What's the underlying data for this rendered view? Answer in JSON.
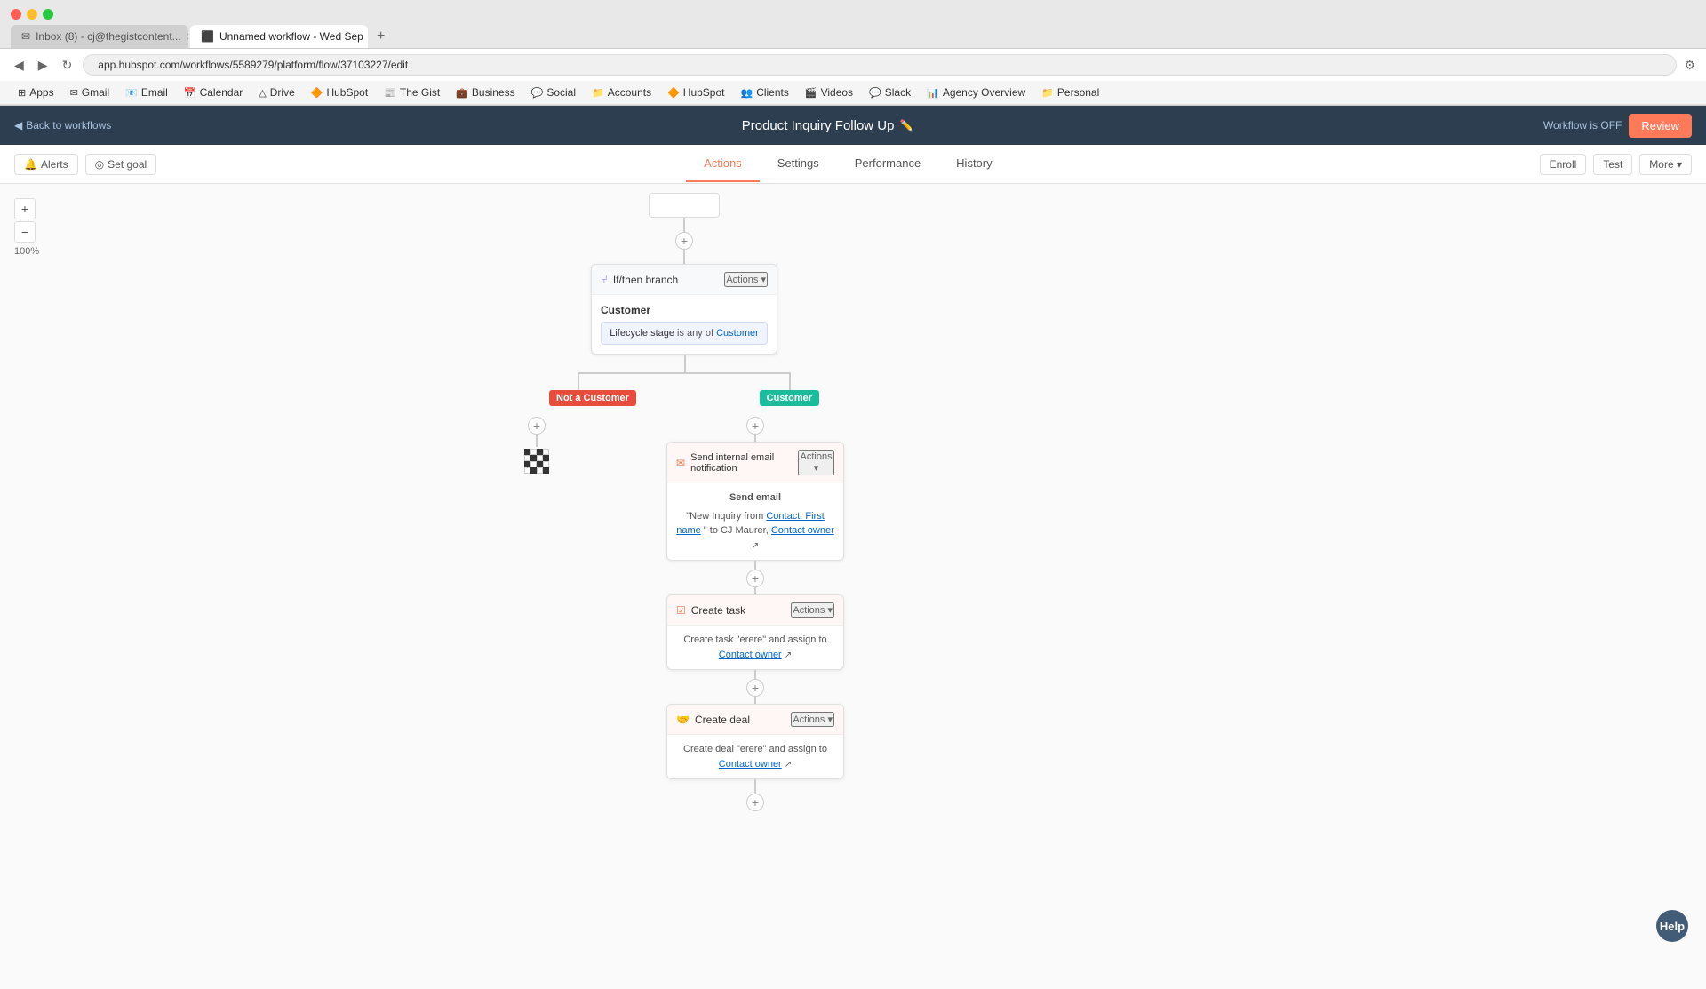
{
  "browser": {
    "tabs": [
      {
        "id": "gmail",
        "label": "Inbox (8) - cj@thegistcontent...",
        "active": false,
        "icon": "✉"
      },
      {
        "id": "workflow",
        "label": "Unnamed workflow - Wed Sep",
        "active": true,
        "icon": "⬛"
      }
    ],
    "address": "app.hubspot.com/workflows/5589279/platform/flow/37103227/edit",
    "new_tab_label": "+"
  },
  "bookmarks": [
    {
      "id": "apps",
      "label": "Apps",
      "icon": "⊞"
    },
    {
      "id": "gmail",
      "label": "Gmail",
      "icon": "✉"
    },
    {
      "id": "email",
      "label": "Email",
      "icon": "📧"
    },
    {
      "id": "calendar",
      "label": "Calendar",
      "icon": "📅"
    },
    {
      "id": "drive",
      "label": "Drive",
      "icon": "△"
    },
    {
      "id": "hubspot",
      "label": "HubSpot",
      "icon": "🔶"
    },
    {
      "id": "gist",
      "label": "The Gist",
      "icon": "📰"
    },
    {
      "id": "business",
      "label": "Business",
      "icon": "💼"
    },
    {
      "id": "social",
      "label": "Social",
      "icon": "💬"
    },
    {
      "id": "accounts",
      "label": "Accounts",
      "icon": "📁"
    },
    {
      "id": "hubspot2",
      "label": "HubSpot",
      "icon": "🔶"
    },
    {
      "id": "clients",
      "label": "Clients",
      "icon": "👥"
    },
    {
      "id": "videos",
      "label": "Videos",
      "icon": "🎬"
    },
    {
      "id": "slack",
      "label": "Slack",
      "icon": "💬"
    },
    {
      "id": "agency",
      "label": "Agency Overview",
      "icon": "📊"
    },
    {
      "id": "personal",
      "label": "Personal",
      "icon": "📁"
    }
  ],
  "header": {
    "back_label": "Back to workflows",
    "title": "Product Inquiry Follow Up",
    "edit_icon": "✏️",
    "status_label": "Workflow is OFF",
    "review_label": "Review"
  },
  "secondary_nav": {
    "alerts_label": "Alerts",
    "set_goal_label": "Set goal",
    "tabs": [
      {
        "id": "actions",
        "label": "Actions",
        "active": true
      },
      {
        "id": "settings",
        "label": "Settings",
        "active": false
      },
      {
        "id": "performance",
        "label": "Performance",
        "active": false
      },
      {
        "id": "history",
        "label": "History",
        "active": false
      }
    ],
    "right_buttons": [
      {
        "id": "enroll",
        "label": "Enroll"
      },
      {
        "id": "test",
        "label": "Test"
      },
      {
        "id": "more",
        "label": "More ▾"
      }
    ]
  },
  "zoom": {
    "plus_label": "+",
    "minus_label": "−",
    "level": "100%"
  },
  "workflow": {
    "if_then_node": {
      "header_type": "If/then branch",
      "actions_label": "Actions ▾",
      "branch_label": "Customer",
      "condition_text": "Lifecycle stage",
      "condition_operator": "is any of",
      "condition_value": "Customer"
    },
    "not_customer_branch": {
      "label": "Not a Customer",
      "end_icon": "checkered"
    },
    "customer_branch": {
      "label": "Customer",
      "nodes": [
        {
          "id": "email-notification",
          "header_type": "Send internal email notification",
          "actions_label": "Actions ▾",
          "body_title": "Send email",
          "body_text": "\"New Inquiry from",
          "body_link1": "Contact: First name",
          "body_text2": "\" to CJ Maurer,",
          "body_link2": "Contact owner",
          "icon": "✉"
        },
        {
          "id": "create-task",
          "header_type": "Create task",
          "actions_label": "Actions ▾",
          "body_text": "Create task \"erere\" and assign to",
          "body_link": "Contact owner",
          "icon": "☑"
        },
        {
          "id": "create-deal",
          "header_type": "Create deal",
          "actions_label": "Actions ▾",
          "body_text": "Create deal \"erere\" and assign to",
          "body_link": "Contact owner",
          "icon": "🤝"
        }
      ]
    }
  },
  "help_btn_label": "Help"
}
